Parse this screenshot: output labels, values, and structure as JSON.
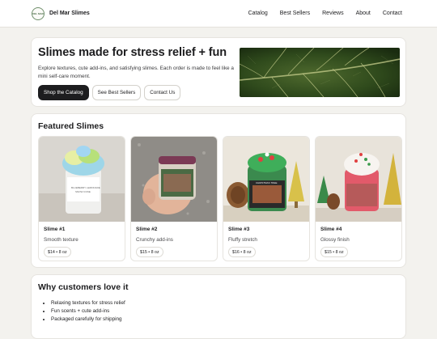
{
  "header": {
    "logo_text": "DEL MAR",
    "brand": "Del Mar Slimes",
    "nav": [
      "Catalog",
      "Best Sellers",
      "Reviews",
      "About",
      "Contact"
    ]
  },
  "hero": {
    "title": "Slimes made for stress relief + fun",
    "subtitle": "Explore textures, cute add-ins, and satisfying slimes. Each order is made to feel like a mini self-care moment.",
    "primary_button": "Shop the Catalog",
    "secondary_button": "See Best Sellers",
    "tertiary_button": "Contact Us",
    "image": "green-leaf-photo"
  },
  "featured": {
    "heading": "Featured Slimes",
    "products": [
      {
        "name": "Slime #1",
        "desc": "Smooth texture",
        "price": "$14 • 8 oz",
        "image": "blue-green-slime-jar"
      },
      {
        "name": "Slime #2",
        "desc": "Crunchy add-ins",
        "price": "$15 • 8 oz",
        "image": "hand-holding-slime-jar"
      },
      {
        "name": "Slime #3",
        "desc": "Fluffy stretch",
        "price": "$16 • 8 oz",
        "image": "green-christmas-slime-jar"
      },
      {
        "name": "Slime #4",
        "desc": "Glossy finish",
        "price": "$15 • 8 oz",
        "image": "pink-holiday-slime-jar"
      }
    ]
  },
  "why": {
    "heading": "Why customers love it",
    "items": [
      "Relaxing textures for stress relief",
      "Fun scents + cute add-ins",
      "Packaged carefully for shipping"
    ]
  },
  "colors": {
    "primary_button": "#1d1d1f",
    "background": "#f3f2ee",
    "card": "#ffffff"
  }
}
